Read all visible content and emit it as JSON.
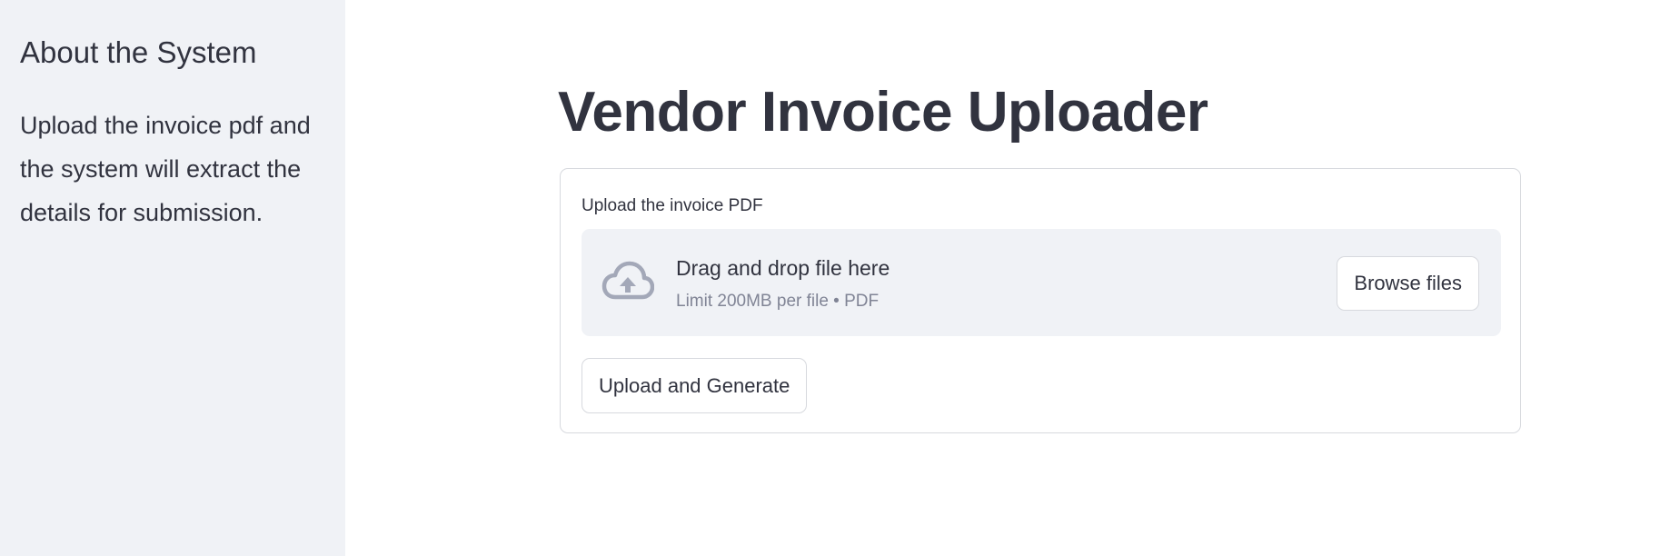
{
  "sidebar": {
    "title": "About the System",
    "description": "Upload the invoice pdf and the system will extract the details for submission."
  },
  "main": {
    "title": "Vendor Invoice Uploader",
    "uploader": {
      "label": "Upload the invoice PDF",
      "icon": "cloud-upload-icon",
      "drop_text": "Drag and drop file here",
      "limit_text": "Limit 200MB per file • PDF",
      "browse_label": "Browse files"
    },
    "submit_label": "Upload and Generate"
  },
  "colors": {
    "text": "#31333f",
    "muted": "#808495",
    "sidebar_bg": "#f0f2f6",
    "border": "#d7d9de",
    "icon": "#a3a8b8"
  }
}
